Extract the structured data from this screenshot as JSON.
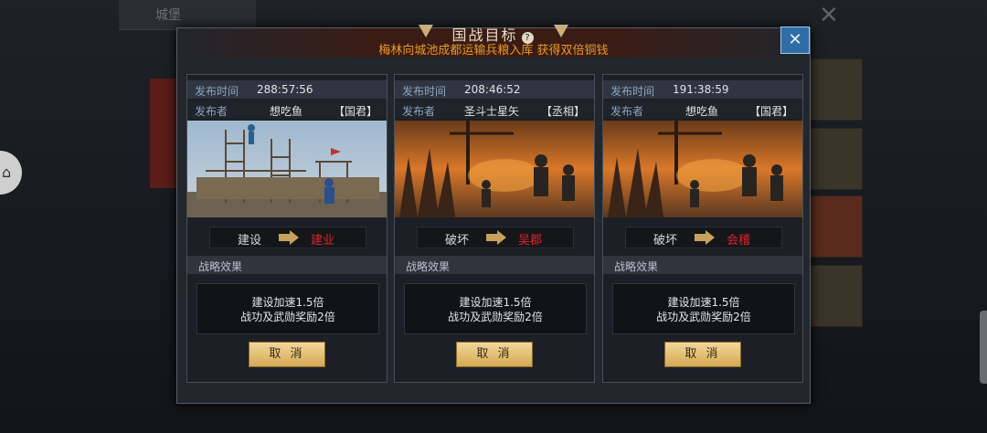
{
  "background": {
    "topbar_label": "城堡",
    "close_glyph": "✕",
    "dock_glyph": "⌂"
  },
  "dialog": {
    "title": "国战目标",
    "help_glyph": "?",
    "subtitle": "梅林向城池成都运输兵粮入库 获得双倍铜钱",
    "close_glyph": "✕"
  },
  "labels": {
    "publish_time": "发布时间",
    "publisher": "发布者",
    "effects_header": "战略效果"
  },
  "cards": [
    {
      "time": "288:57:56",
      "publisher": "想吃鱼",
      "rank": "【国君】",
      "action": "建设",
      "target": "建业",
      "effect_line1": "建设加速1.5倍",
      "effect_line2": "战功及武勋奖励2倍",
      "cancel_label": "取 消",
      "image": "construction-scene"
    },
    {
      "time": "208:46:52",
      "publisher": "圣斗士星矢",
      "rank": "【丞相】",
      "action": "破坏",
      "target": "吴郡",
      "effect_line1": "建设加速1.5倍",
      "effect_line2": "战功及武勋奖励2倍",
      "cancel_label": "取 消",
      "image": "battle-scene"
    },
    {
      "time": "191:38:59",
      "publisher": "想吃鱼",
      "rank": "【国君】",
      "action": "破坏",
      "target": "会稽",
      "effect_line1": "建设加速1.5倍",
      "effect_line2": "战功及武勋奖励2倍",
      "cancel_label": "取 消",
      "image": "battle-scene"
    }
  ],
  "colors": {
    "target_red": "#e2232a",
    "subtitle_orange": "#e89a2c",
    "close_blue": "#2e6da6"
  }
}
